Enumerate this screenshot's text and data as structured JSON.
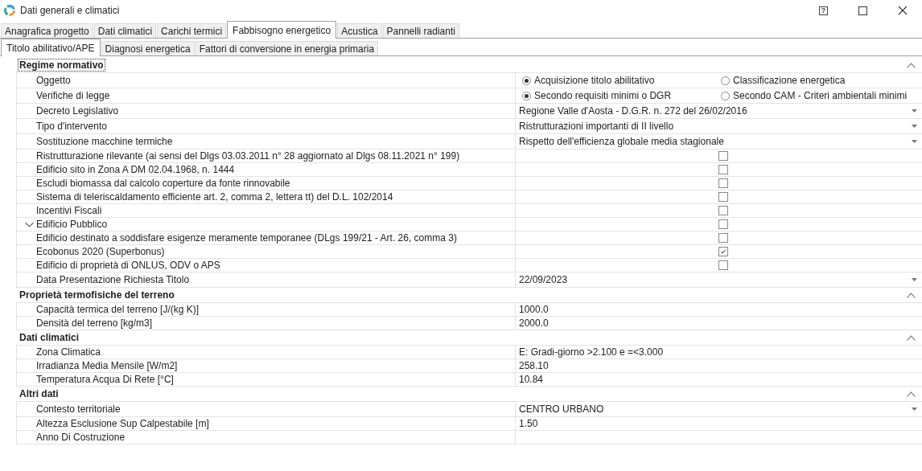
{
  "window": {
    "title": "Dati generali e climatici",
    "help_button": "?"
  },
  "tabs": [
    {
      "label": "Anagrafica progetto",
      "selected": false
    },
    {
      "label": "Dati climatici",
      "selected": false
    },
    {
      "label": "Carichi termici",
      "selected": false
    },
    {
      "label": "Fabbisogno energetico",
      "selected": true
    },
    {
      "label": "Acustica",
      "selected": false
    },
    {
      "label": "Pannelli radianti",
      "selected": false
    }
  ],
  "subtabs": [
    {
      "label": "Titolo abilitativo/APE",
      "selected": true
    },
    {
      "label": "Diagnosi energetica",
      "selected": false
    },
    {
      "label": "Fattori di conversione in energia primaria",
      "selected": false
    }
  ],
  "categories": [
    {
      "title": "Regime normativo",
      "expanded": true,
      "focused": true,
      "rows": [
        {
          "label": "Oggetto",
          "kind": "radio",
          "options": [
            {
              "label": "Acquisizione titolo abilitativo",
              "selected": true
            },
            {
              "label": "Classificazione energetica",
              "selected": false
            }
          ]
        },
        {
          "label": "Verifiche di legge",
          "kind": "radio",
          "options": [
            {
              "label": "Secondo requisiti minimi o DGR",
              "selected": true
            },
            {
              "label": "Secondo CAM - Criteri ambientali minimi",
              "selected": false
            }
          ]
        },
        {
          "label": "Decreto Legislativo",
          "kind": "dropdown",
          "value": "Regione Valle d'Aosta - D.G.R. n. 272 del 26/02/2016"
        },
        {
          "label": "Tipo d'intervento",
          "kind": "dropdown",
          "value": "Ristrutturazioni importanti di II livello"
        },
        {
          "label": "Sostituzione macchine termiche",
          "kind": "dropdown",
          "value": "Rispetto dell'efficienza globale media stagionale"
        },
        {
          "label": "Ristrutturazione rilevante (ai sensi del Dlgs 03.03.2011 n° 28 aggiornato al Dlgs 08.11.2021 n° 199)",
          "kind": "checkbox",
          "checked": false
        },
        {
          "label": "Edificio sito in Zona A DM 02.04.1968, n. 1444",
          "kind": "checkbox",
          "checked": false
        },
        {
          "label": "Escludi biomassa dal calcolo coperture da fonte rinnovabile",
          "kind": "checkbox",
          "checked": false
        },
        {
          "label": "Sistema di teleriscaldamento efficiente art. 2, comma 2, lettera tt) del D.L. 102/2014",
          "kind": "checkbox",
          "checked": false
        },
        {
          "label": "Incentivi Fiscali",
          "kind": "checkbox",
          "checked": false
        },
        {
          "label": "Edificio Pubblico",
          "kind": "checkbox",
          "checked": false,
          "expanded": false
        },
        {
          "label": "Edificio destinato a soddisfare esigenze meramente temporanee (DLgs 199/21 - Art. 26, comma 3)",
          "kind": "checkbox",
          "checked": false
        },
        {
          "label": "Ecobonus 2020 (Superbonus)",
          "kind": "checkbox",
          "checked": true
        },
        {
          "label": "Edificio di proprietà di ONLUS, ODV o APS",
          "kind": "checkbox",
          "checked": false
        },
        {
          "label": "Data Presentazione Richiesta Titolo",
          "kind": "dropdown",
          "value": "22/09/2023"
        }
      ]
    },
    {
      "title": "Proprietà termofisiche del terreno",
      "expanded": true,
      "focused": false,
      "rows": [
        {
          "label": "Capacità termica del terreno [J/(kg K)]",
          "kind": "text",
          "value": "1000.0"
        },
        {
          "label": "Densità del terreno [kg/m3]",
          "kind": "text",
          "value": "2000.0"
        }
      ]
    },
    {
      "title": "Dati climatici",
      "expanded": true,
      "focused": false,
      "rows": [
        {
          "label": "Zona Climatica",
          "kind": "text",
          "value": "E: Gradi-giorno >2.100 e  =<3.000"
        },
        {
          "label": "Irradianza Media Mensile [W/m2]",
          "kind": "text",
          "value": "258.10"
        },
        {
          "label": "Temperatura Acqua Di Rete [°C]",
          "kind": "text",
          "value": "10.84"
        }
      ]
    },
    {
      "title": "Altri dati",
      "expanded": true,
      "focused": false,
      "rows": [
        {
          "label": "Contesto territoriale",
          "kind": "dropdown",
          "value": "CENTRO URBANO"
        },
        {
          "label": "Altezza Esclusione Sup Calpestabile [m]",
          "kind": "text",
          "value": "1.50"
        },
        {
          "label": "Anno Di Costruzione",
          "kind": "text",
          "value": ""
        }
      ]
    }
  ]
}
